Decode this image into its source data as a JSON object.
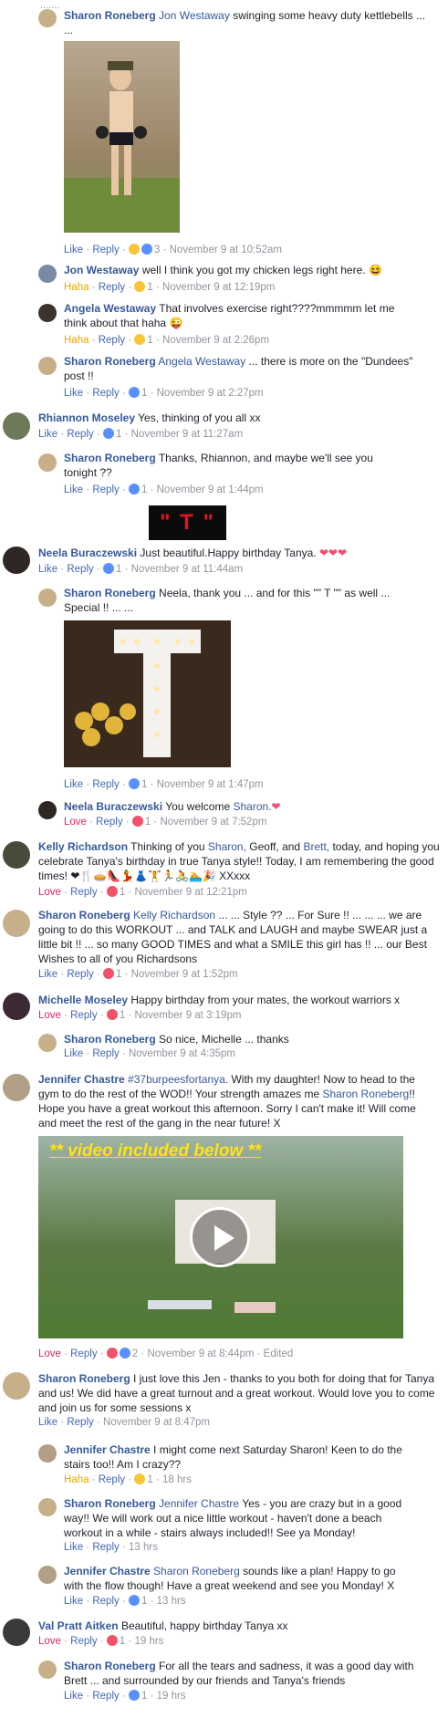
{
  "comments": [
    {
      "author": "Sharon Roneberg",
      "tag": "Jon Westaway",
      "text": "swinging some heavy duty kettlebells ... ...",
      "actions": {
        "like": "Like",
        "reply": "Reply",
        "count": "3",
        "time": "November 9 at 10:52am"
      }
    },
    {
      "author": "Jon Westaway",
      "text": "well I think you got my chicken legs right here.",
      "actions": {
        "react": "Haha",
        "reply": "Reply",
        "count": "1",
        "time": "November 9 at 12:19pm"
      }
    },
    {
      "author": "Angela Westaway",
      "text": "That involves exercise right????mmmmm let me think about that haha",
      "actions": {
        "react": "Haha",
        "reply": "Reply",
        "count": "1",
        "time": "November 9 at 2:26pm"
      }
    },
    {
      "author": "Sharon Roneberg",
      "tag": "Angela Westaway",
      "text": "... there is more on the \"Dundees\" post !!",
      "actions": {
        "like": "Like",
        "reply": "Reply",
        "count": "1",
        "time": "November 9 at 2:27pm"
      }
    },
    {
      "author": "Rhiannon Moseley",
      "text": "Yes, thinking of you all xx",
      "actions": {
        "like": "Like",
        "reply": "Reply",
        "count": "1",
        "time": "November 9 at 11:27am"
      }
    },
    {
      "author": "Sharon Roneberg",
      "text": "Thanks, Rhiannon, and maybe we'll see you tonight ??",
      "actions": {
        "like": "Like",
        "reply": "Reply",
        "count": "1",
        "time": "November 9 at 1:44pm"
      }
    },
    {
      "image_text": "\" T \""
    },
    {
      "author": "Neela Buraczewski",
      "text": "Just beautiful.Happy birthday Tanya.",
      "actions": {
        "like": "Like",
        "reply": "Reply",
        "count": "1",
        "time": "November 9 at 11:44am"
      }
    },
    {
      "author": "Sharon Roneberg",
      "text": "Neela, thank you ... and for this \"\" T \"\" as well ... Special !! ... ...",
      "actions": {
        "like": "Like",
        "reply": "Reply",
        "count": "1",
        "time": "November 9 at 1:47pm"
      }
    },
    {
      "author": "Neela Buraczewski",
      "text": "You welcome",
      "tag": "Sharon.",
      "actions": {
        "react": "Love",
        "reply": "Reply",
        "count": "1",
        "time": "November 9 at 7:52pm"
      }
    },
    {
      "author": "Kelly Richardson",
      "text_a": "Thinking of you",
      "tag1": "Sharon,",
      "text_b": "Geoff, and",
      "tag2": "Brett,",
      "text_c": "today, and hoping you celebrate Tanya's birthday in true Tanya style!! Today, I am remembering the good times!",
      "text_d": "XXxxx",
      "actions": {
        "react": "Love",
        "reply": "Reply",
        "count": "1",
        "time": "November 9 at 12:21pm"
      }
    },
    {
      "author": "Sharon Roneberg",
      "tag": "Kelly Richardson",
      "text": "... ... Style ?? ... For Sure !! ... ... ... we are going to do this WORKOUT ... and TALK and LAUGH and maybe SWEAR just a little bit !! ... so many GOOD TIMES and what a SMILE this girl has !! ... our Best Wishes to all of you Richardsons",
      "actions": {
        "like": "Like",
        "reply": "Reply",
        "count": "1",
        "time": "November 9 at 1:52pm"
      }
    },
    {
      "author": "Michelle Moseley",
      "text": "Happy birthday from your mates, the workout warriors x",
      "actions": {
        "react": "Love",
        "reply": "Reply",
        "count": "1",
        "time": "November 9 at 3:19pm"
      }
    },
    {
      "author": "Sharon Roneberg",
      "text": "So nice, Michelle ... thanks",
      "actions": {
        "like": "Like",
        "reply": "Reply",
        "time": "November 9 at 4:35pm"
      }
    },
    {
      "author": "Jennifer Chastre",
      "hashtag": "#37burpeesfortanya.",
      "text_a": "With my daughter! Now to head to the gym to do the rest of the WOD!! Your strength amazes me",
      "tag": "Sharon Roneberg",
      "text_b": "!! Hope you have a great workout this afternoon. Sorry I can't make it! Will come and meet the rest of the gang in the near future! X",
      "video_caption": "** video included below **",
      "actions": {
        "react": "Love",
        "reply": "Reply",
        "count": "2",
        "time": "November 9 at 8:44pm",
        "edited": "Edited"
      }
    },
    {
      "author": "Sharon Roneberg",
      "text": "I just love this Jen - thanks to you both for doing that for Tanya and us! We did have a great turnout and a great workout. Would love you to come and join us for some sessions x",
      "actions": {
        "like": "Like",
        "reply": "Reply",
        "time": "November 9 at 8:47pm"
      }
    },
    {
      "author": "Jennifer Chastre",
      "text": "I might come next Saturday Sharon! Keen to do the stairs too!! Am I crazy??",
      "actions": {
        "react": "Haha",
        "reply": "Reply",
        "count": "1",
        "time": "18 hrs"
      }
    },
    {
      "author": "Sharon Roneberg",
      "tag": "Jennifer Chastre",
      "text": "Yes - you are crazy but in a good way!! We will work out a nice little workout - haven't done a beach workout in a while - stairs always included!! See ya Monday!",
      "actions": {
        "like": "Like",
        "reply": "Reply",
        "time": "13 hrs"
      }
    },
    {
      "author": "Jennifer Chastre",
      "tag": "Sharon Roneberg",
      "text": "sounds like a plan! Happy to go with the flow though! Have a great weekend and see you Monday! X",
      "actions": {
        "like": "Like",
        "reply": "Reply",
        "count": "1",
        "time": "13 hrs"
      }
    },
    {
      "author": "Val Pratt Aitken",
      "text": "Beautiful, happy birthday Tanya xx",
      "actions": {
        "react": "Love",
        "reply": "Reply",
        "count": "1",
        "time": "19 hrs"
      }
    },
    {
      "author": "Sharon Roneberg",
      "text": "For all the tears and sadness, it was a good day with Brett ... and surrounded by our friends and Tanya's friends",
      "actions": {
        "like": "Like",
        "reply": "Reply",
        "count": "1",
        "time": "19 hrs"
      }
    }
  ],
  "colors": {
    "link": "#365899",
    "meta": "#90949c",
    "love": "#e0245e",
    "haha": "#e9a800",
    "like_blue": "#4267b2"
  }
}
